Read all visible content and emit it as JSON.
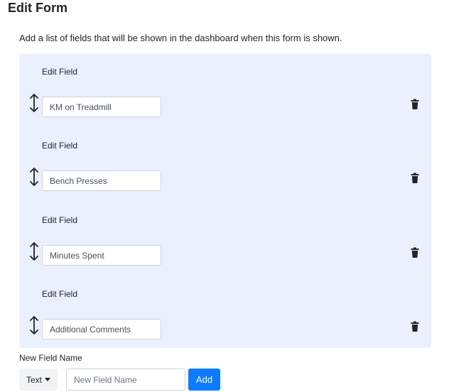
{
  "page": {
    "title": "Edit Form",
    "description": "Add a list of fields that will be shown in the dashboard when this form is shown."
  },
  "fields": [
    {
      "label": "Edit Field",
      "value": "KM on Treadmill"
    },
    {
      "label": "Edit Field",
      "value": "Bench Presses"
    },
    {
      "label": "Edit Field",
      "value": "Minutes Spent"
    },
    {
      "label": "Edit Field",
      "value": "Additional Comments"
    }
  ],
  "new_field": {
    "label": "New Field Name",
    "type_selected": "Text",
    "placeholder": "New Field Name",
    "add_label": "Add"
  },
  "icons": {
    "drag": "drag-handle-icon",
    "delete": "trash-icon",
    "dropdown": "caret-down-icon"
  },
  "colors": {
    "panel_background": "#eaf0fd",
    "primary_button": "#0d7bff",
    "select_background": "#f1f3f5",
    "text": "#212529"
  }
}
